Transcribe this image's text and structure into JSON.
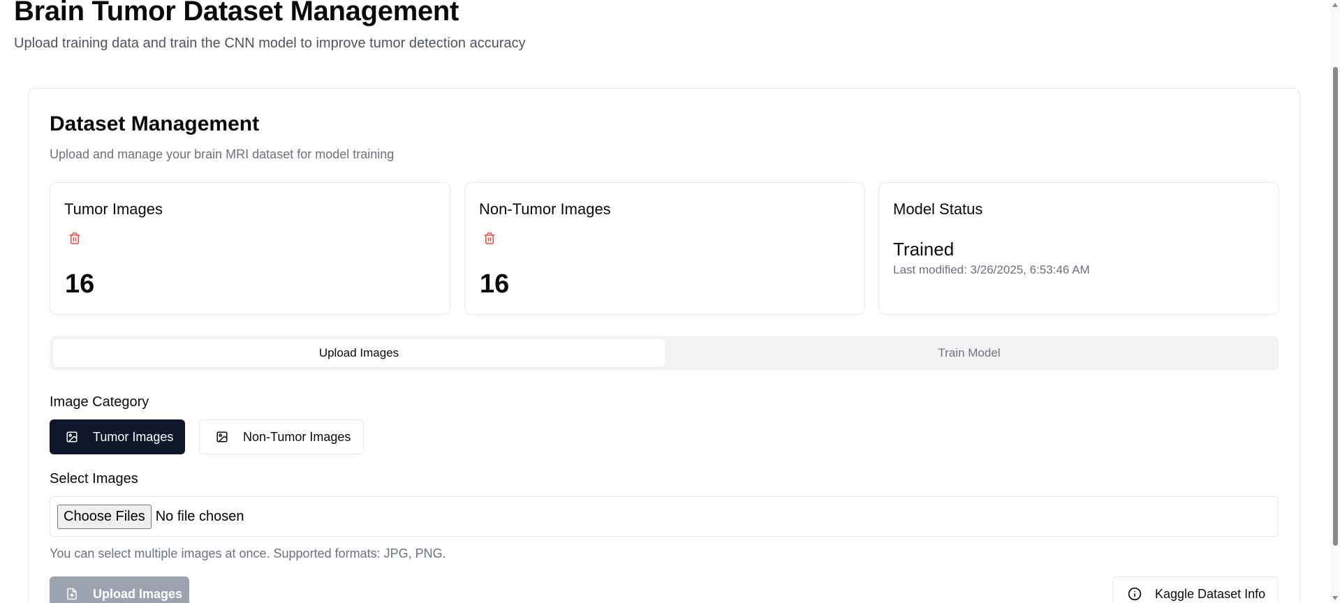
{
  "header": {
    "title": "Brain Tumor Dataset Management",
    "subtitle": "Upload training data and train the CNN model to improve tumor detection accuracy"
  },
  "card": {
    "title": "Dataset Management",
    "description": "Upload and manage your brain MRI dataset for model training"
  },
  "stats": {
    "tumor": {
      "title": "Tumor Images",
      "count": "16",
      "delete_icon": "trash-icon"
    },
    "non_tumor": {
      "title": "Non-Tumor Images",
      "count": "16",
      "delete_icon": "trash-icon"
    },
    "model": {
      "title": "Model Status",
      "status": "Trained",
      "last_modified": "Last modified: 3/26/2025, 6:53:46 AM"
    }
  },
  "tabs": [
    {
      "label": "Upload Images",
      "active": true
    },
    {
      "label": "Train Model",
      "active": false
    }
  ],
  "category": {
    "label": "Image Category",
    "options": [
      {
        "label": "Tumor Images",
        "icon": "image-icon",
        "selected": true
      },
      {
        "label": "Non-Tumor Images",
        "icon": "image-icon",
        "selected": false
      }
    ]
  },
  "select_images": {
    "label": "Select Images",
    "button_label": "Choose Files",
    "status": "No file chosen",
    "hint": "You can select multiple images at once. Supported formats: JPG, PNG."
  },
  "actions": {
    "upload_label": "Upload Images",
    "upload_icon": "file-upload-icon",
    "kaggle_label": "Kaggle Dataset Info",
    "kaggle_icon": "info-icon"
  },
  "colors": {
    "primary": "#0f172a",
    "danger": "#ef4444",
    "muted": "#6b7280",
    "border": "#e5e7eb",
    "disabled": "#9ca3af"
  }
}
